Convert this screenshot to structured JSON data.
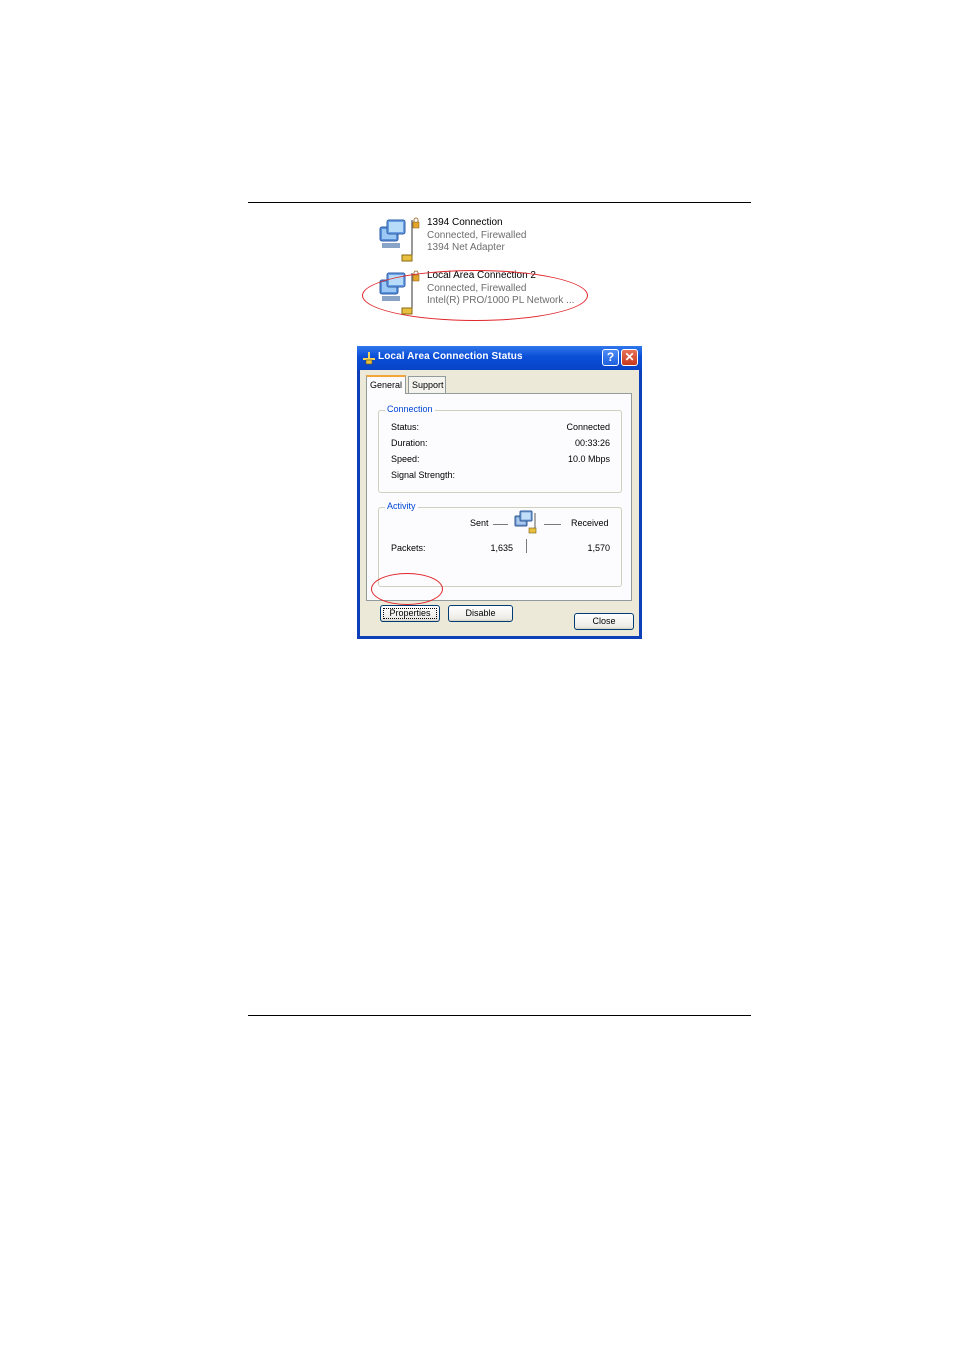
{
  "connections": [
    {
      "name": "1394 Connection",
      "status": "Connected, Firewalled",
      "device": "1394 Net Adapter"
    },
    {
      "name": "Local Area Connection 2",
      "status": "Connected, Firewalled",
      "device": "Intel(R) PRO/1000 PL Network ..."
    }
  ],
  "dialog": {
    "title": "Local Area Connection Status",
    "help_glyph": "?",
    "close_glyph": "✕",
    "tabs": [
      "General",
      "Support"
    ],
    "connection_group": {
      "legend": "Connection",
      "rows": [
        {
          "label": "Status:",
          "value": "Connected"
        },
        {
          "label": "Duration:",
          "value": "00:33:26"
        },
        {
          "label": "Speed:",
          "value": "10.0 Mbps"
        },
        {
          "label": "Signal Strength:",
          "value": ""
        }
      ]
    },
    "activity_group": {
      "legend": "Activity",
      "sent_label": "Sent",
      "received_label": "Received",
      "packets_label": "Packets:",
      "packets_sent": "1,635",
      "packets_received": "1,570"
    },
    "buttons": {
      "properties": "Properties",
      "disable": "Disable",
      "close": "Close"
    }
  },
  "colors": {
    "highlight": "#e0262b",
    "titlebar": "#0a4ed6",
    "group_legend": "#0046d5"
  },
  "icons": [
    "network-connection-icon",
    "lock-icon",
    "dialog-network-icon",
    "help-icon",
    "close-icon",
    "activity-computers-icon"
  ]
}
